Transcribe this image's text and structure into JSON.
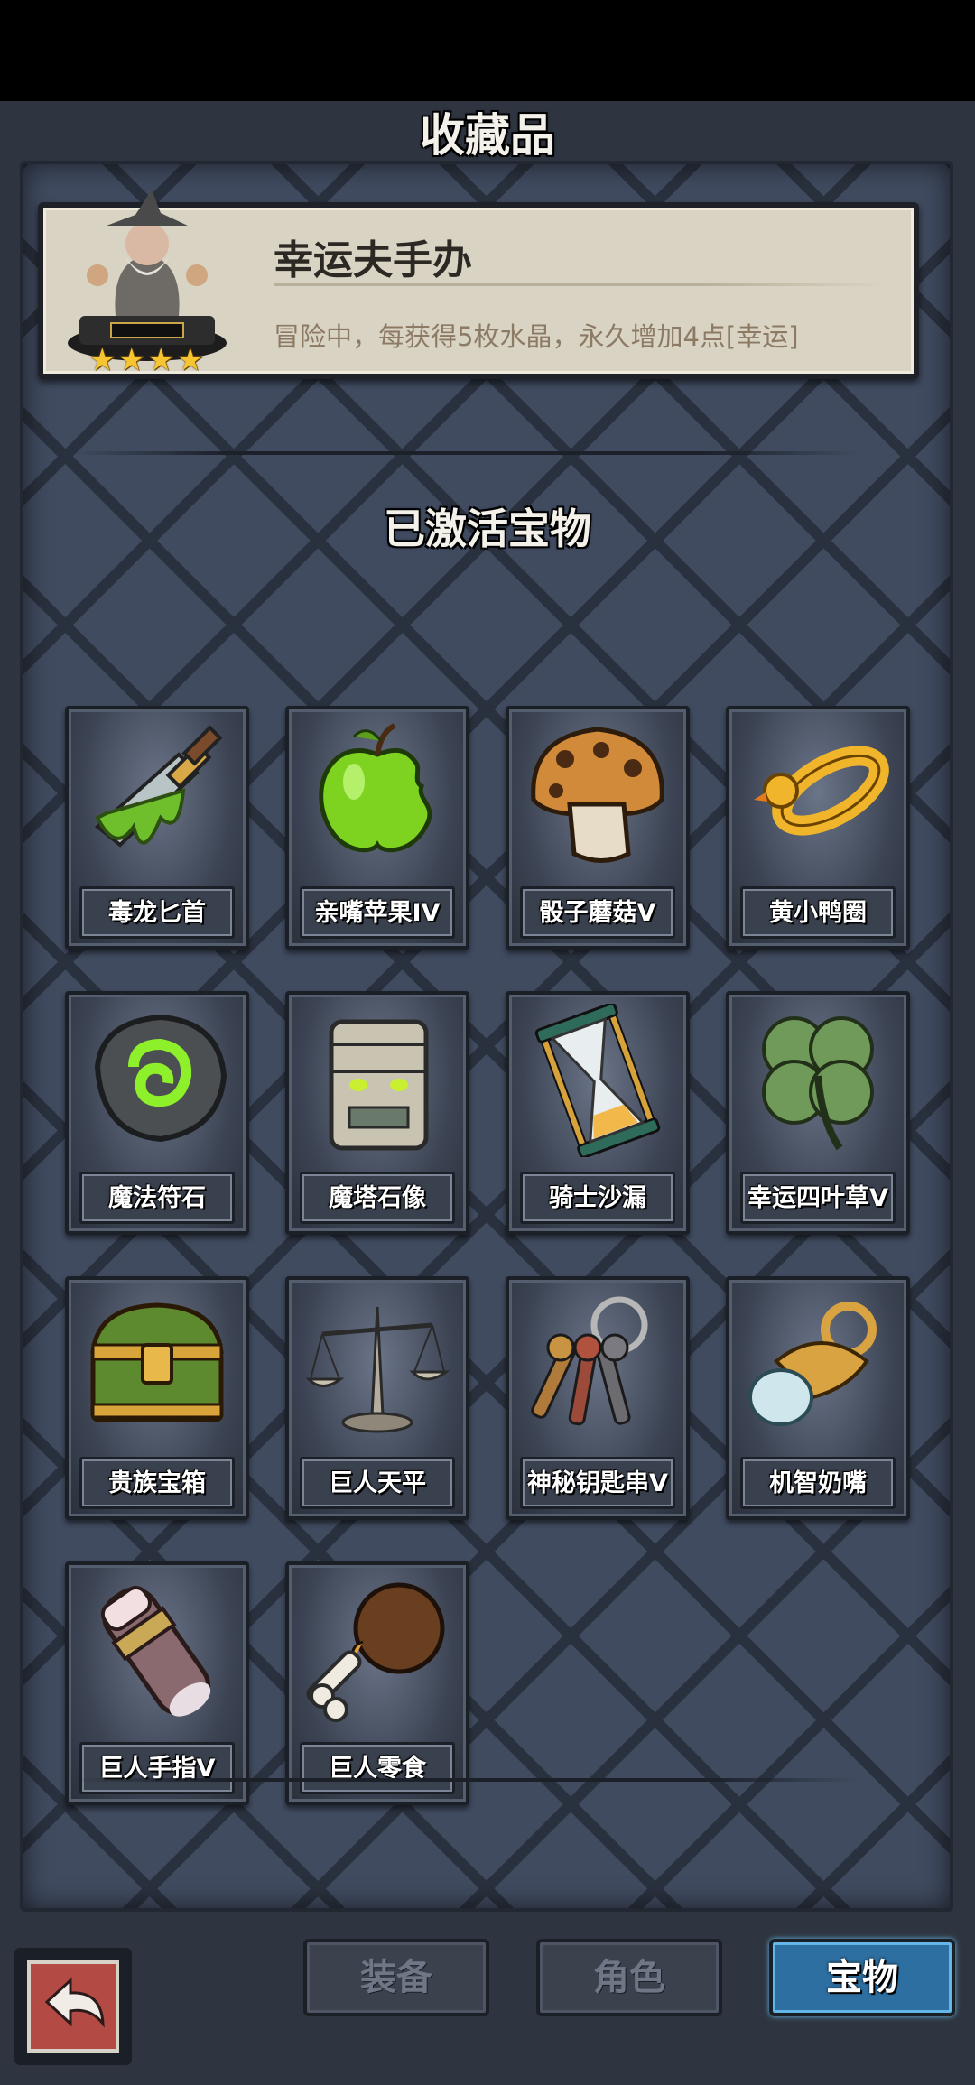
{
  "header": {
    "title": "收藏品"
  },
  "featured": {
    "name": "幸运夫手办",
    "description": "冒险中，每获得5枚水晶，永久增加4点[幸运]",
    "stars": 4
  },
  "section_title": "已激活宝物",
  "items": [
    {
      "label": "毒龙匕首",
      "icon": "poison-dagger-icon"
    },
    {
      "label": "亲嘴苹果IV",
      "icon": "bitten-apple-icon"
    },
    {
      "label": "骰子蘑菇V",
      "icon": "dice-mushroom-icon"
    },
    {
      "label": "黄小鸭圈",
      "icon": "duck-ring-icon"
    },
    {
      "label": "魔法符石",
      "icon": "rune-stone-icon"
    },
    {
      "label": "魔塔石像",
      "icon": "tower-statue-icon"
    },
    {
      "label": "骑士沙漏",
      "icon": "hourglass-icon"
    },
    {
      "label": "幸运四叶草V",
      "icon": "four-leaf-clover-icon"
    },
    {
      "label": "贵族宝箱",
      "icon": "treasure-chest-icon"
    },
    {
      "label": "巨人天平",
      "icon": "balance-scale-icon"
    },
    {
      "label": "神秘钥匙串V",
      "icon": "key-ring-icon"
    },
    {
      "label": "机智奶嘴",
      "icon": "pacifier-icon"
    },
    {
      "label": "巨人手指V",
      "icon": "giant-finger-icon"
    },
    {
      "label": "巨人零食",
      "icon": "drumstick-icon"
    }
  ],
  "bottom_tabs": [
    {
      "label": "装备",
      "active": false
    },
    {
      "label": "角色",
      "active": false
    },
    {
      "label": "宝物",
      "active": true
    }
  ],
  "colors": {
    "panel": "#404b60",
    "card": "#d8d3c2",
    "active_tab": "#2d6fa0",
    "star": "#f6c531"
  }
}
